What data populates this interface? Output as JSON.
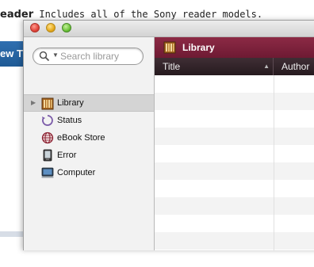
{
  "background": {
    "heading_bold": "eader",
    "heading_text": " Includes all of the Sony reader models.",
    "tab_text": "ew T"
  },
  "window": {
    "search": {
      "placeholder": "Search library"
    },
    "sidebar": {
      "items": [
        {
          "label": "Library",
          "icon": "library-icon",
          "selected": true
        },
        {
          "label": "Status",
          "icon": "status-icon"
        },
        {
          "label": "eBook Store",
          "icon": "globe-icon"
        },
        {
          "label": "Error",
          "icon": "device-icon"
        },
        {
          "label": "Computer",
          "icon": "computer-icon"
        }
      ]
    },
    "main": {
      "header_title": "Library",
      "columns": [
        "Title",
        "Author"
      ],
      "header_color": "#7d2340"
    }
  }
}
